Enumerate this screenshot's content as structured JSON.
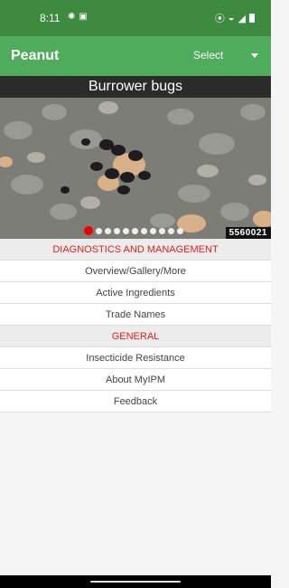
{
  "status_bar": {
    "time": "8:11",
    "left_icons": [
      "sun-icon",
      "id-card-icon"
    ],
    "right_icons": [
      "vibrate-icon",
      "wifi-icon",
      "signal-icon",
      "battery-icon"
    ]
  },
  "app_bar": {
    "title": "Peanut",
    "select_label": "Select"
  },
  "hero": {
    "title": "Burrower bugs",
    "image_id": "5560021",
    "slide_count": 11,
    "active_slide": 1
  },
  "sections": [
    {
      "header": "DIAGNOSTICS AND MANAGEMENT",
      "items": [
        "Overview/Gallery/More",
        "Active Ingredients",
        "Trade Names"
      ]
    },
    {
      "header": "GENERAL",
      "items": [
        "Insecticide Resistance",
        "About MyIPM",
        "Feedback"
      ]
    }
  ],
  "colors": {
    "status_bar": "#3c8b3f",
    "app_bar": "#4eac5c",
    "section_header_text": "#e0201e",
    "active_dot": "#ee0000"
  }
}
